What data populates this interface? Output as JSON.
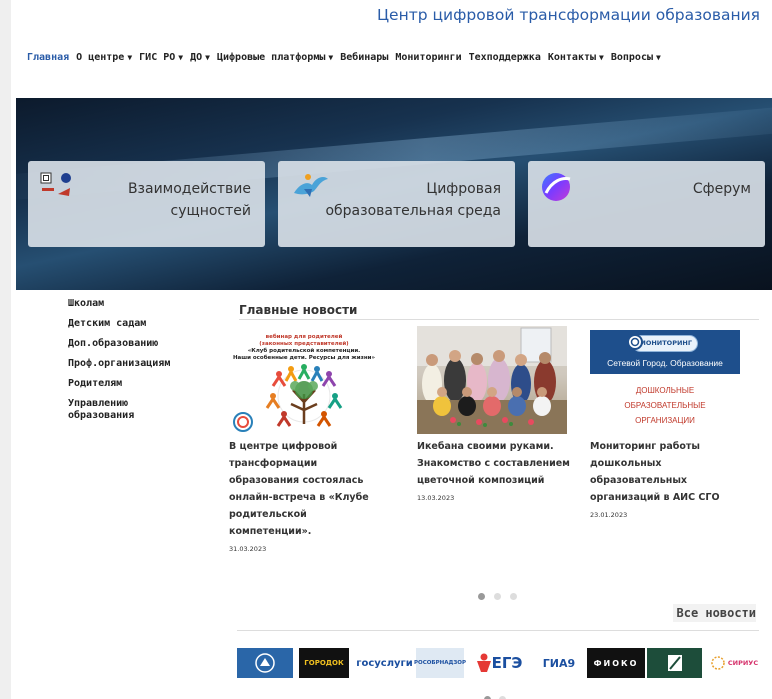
{
  "site": {
    "title": "Центр цифровой трансформации образования"
  },
  "nav": [
    {
      "label": "Главная",
      "has_dropdown": false,
      "active": true
    },
    {
      "label": "О центре",
      "has_dropdown": true
    },
    {
      "label": "ГИС РО",
      "has_dropdown": true
    },
    {
      "label": "ДО",
      "has_dropdown": true
    },
    {
      "label": "Цифровые платформы",
      "has_dropdown": true
    },
    {
      "label": "Вебинары",
      "has_dropdown": false
    },
    {
      "label": "Мониторинги",
      "has_dropdown": false
    },
    {
      "label": "Техподдержка",
      "has_dropdown": false
    },
    {
      "label": "Контакты",
      "has_dropdown": true
    },
    {
      "label": "Вопросы",
      "has_dropdown": true
    }
  ],
  "caret": "▼",
  "hero": {
    "cards": [
      {
        "label_lines": [
          "Взаимодействие",
          "сущностей"
        ],
        "icon": "org-logos-icon"
      },
      {
        "label_lines": [
          "Цифровая",
          "образовательная среда"
        ],
        "icon": "dove-logo-icon"
      },
      {
        "label_lines": [
          "Сферум"
        ],
        "icon": "sferum-logo-icon"
      }
    ],
    "active_slide": 0,
    "slide_count": 3
  },
  "sidemenu": [
    "Школам",
    "Детским садам",
    "Доп.образованию",
    "Проф.организациям",
    "Родителям",
    "Управлению образования"
  ],
  "news": {
    "title": "Главные новости",
    "items": [
      {
        "headline": "В центре цифровой трансформации образования состоялась онлайн-встреча в «Клубе родительской компетенции».",
        "date": "31.03.2023",
        "image_text": {
          "line1": "вебинар для родителей",
          "line2": "(законных представителей)",
          "line3": "«Клуб родительской компетенции.",
          "line4": "Наши особенные дети. Ресурсы для жизни»"
        }
      },
      {
        "headline": "Икебана своими руками. Знакомство с составлением цветочной композиций",
        "date": "13.03.2023"
      },
      {
        "headline": "Мониторинг работы дошкольных образовательных организаций в АИС СГО",
        "date": "23.01.2023",
        "image_text": {
          "badge": "МОНИТОРИНГ",
          "banner": "Сетевой Город. Образование",
          "line1": "ДОШКОЛЬНЫЕ",
          "line2": "ОБРАЗОВАТЕЛЬНЫЕ",
          "line3": "ОРГАНИЗАЦИИ"
        }
      }
    ],
    "page_count": 3,
    "active_page": 0,
    "all_label": "Все новости"
  },
  "partners": [
    {
      "name": "Министерство образования",
      "text": ""
    },
    {
      "name": "ГородОК",
      "text": "ГОРОДОК"
    },
    {
      "name": "Госуслуги",
      "text": "госуслуги"
    },
    {
      "name": "Рособрнадзор",
      "text": "РОСОБРНАДЗОР"
    },
    {
      "name": "ЕГЭ",
      "text": "ЕГЭ"
    },
    {
      "name": "ГИА9",
      "text": "ГИА9"
    },
    {
      "name": "ФИОКО",
      "text": "ФИОКО"
    },
    {
      "name": "Сириус",
      "text": "СИРИУС"
    }
  ],
  "colors": {
    "accent": "#2a5ca8",
    "news_red": "#c0392b"
  }
}
